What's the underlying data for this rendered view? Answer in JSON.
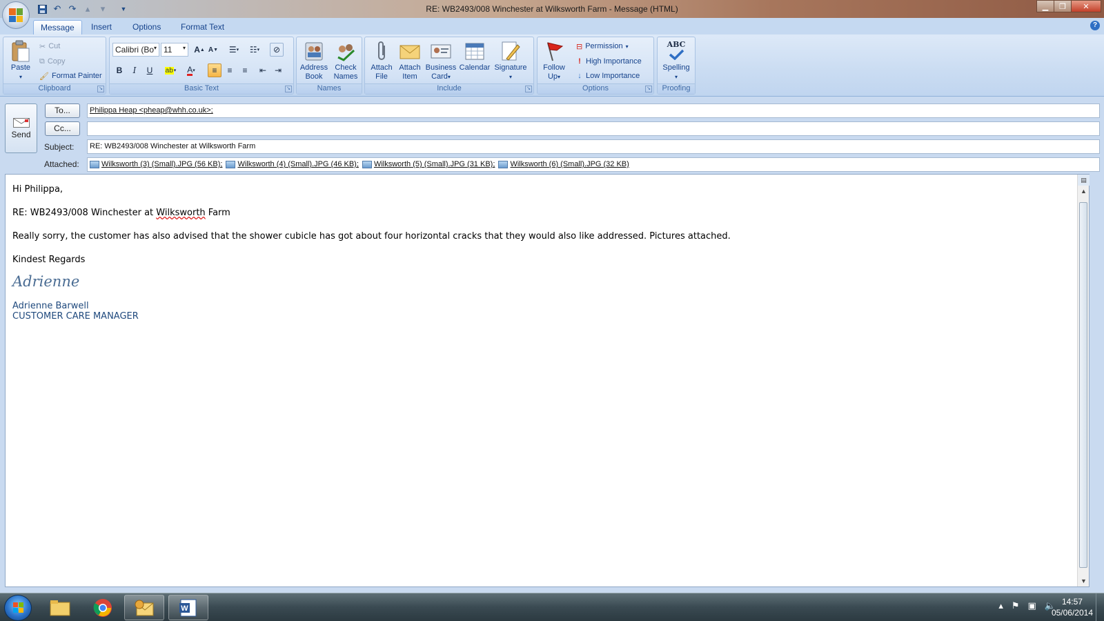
{
  "window": {
    "title": "RE: WB2493/008 Winchester at Wilksworth Farm  -  Message (HTML)",
    "controls": [
      "minimize",
      "maximize",
      "close"
    ]
  },
  "quick_access": [
    {
      "name": "save-icon",
      "glyph": "💾"
    },
    {
      "name": "undo-icon",
      "glyph": "↶"
    },
    {
      "name": "redo-icon",
      "glyph": "↷"
    },
    {
      "name": "previous-item-icon",
      "glyph": "▲"
    },
    {
      "name": "next-item-icon",
      "glyph": "▼"
    },
    {
      "name": "customize-qat-icon",
      "glyph": "▾"
    }
  ],
  "tabs": [
    {
      "label": "Message",
      "active": true
    },
    {
      "label": "Insert",
      "active": false
    },
    {
      "label": "Options",
      "active": false
    },
    {
      "label": "Format Text",
      "active": false
    }
  ],
  "ribbon": {
    "clipboard": {
      "label": "Clipboard",
      "paste": "Paste",
      "cut": "Cut",
      "copy": "Copy",
      "format_painter": "Format Painter"
    },
    "basic_text": {
      "label": "Basic Text",
      "font_name": "Calibri (Bo",
      "font_size": "11"
    },
    "names": {
      "label": "Names",
      "address_book": [
        "Address",
        "Book"
      ],
      "check_names": [
        "Check",
        "Names"
      ]
    },
    "include": {
      "label": "Include",
      "attach_file": [
        "Attach",
        "File"
      ],
      "attach_item": [
        "Attach",
        "Item"
      ],
      "business_card": [
        "Business",
        "Card"
      ],
      "calendar": "Calendar",
      "signature": "Signature"
    },
    "options": {
      "label": "Options",
      "follow_up": [
        "Follow",
        "Up"
      ],
      "permission": "Permission",
      "high_importance": "High Importance",
      "low_importance": "Low Importance"
    },
    "proofing": {
      "label": "Proofing",
      "spelling": "Spelling",
      "spelling_icon_text": "ABC"
    }
  },
  "compose": {
    "send_label": "Send",
    "to_button": "To...",
    "cc_button": "Cc...",
    "subject_label": "Subject:",
    "attached_label": "Attached:",
    "to_value": "Philippa Heap <pheap@whh.co.uk>;",
    "cc_value": "",
    "subject_value": "RE: WB2493/008 Winchester at Wilksworth Farm",
    "attachments": [
      "Wilksworth (3) (Small).JPG (56 KB);",
      "Wilksworth (4) (Small).JPG (46 KB);",
      "Wilksworth (5) (Small).JPG (31 KB);",
      "Wilksworth (6) (Small).JPG (32 KB)"
    ]
  },
  "body": {
    "greeting": "Hi Philippa,",
    "ref_prefix": "RE: WB2493/008 Winchester at ",
    "ref_misspelled": "Wilksworth",
    "ref_suffix": " Farm",
    "paragraph": "Really sorry, the customer has also advised that the shower cubicle has got about four horizontal cracks that they would also like addressed.  Pictures attached.",
    "closing": "Kindest Regards",
    "signature_script": "Adrienne",
    "sender_name": "Adrienne Barwell",
    "sender_title": "CUSTOMER CARE MANAGER"
  },
  "taskbar": {
    "apps": [
      {
        "name": "explorer-taskbar-button",
        "icon": "📁",
        "open": false
      },
      {
        "name": "chrome-taskbar-button",
        "icon": "◉",
        "open": false
      },
      {
        "name": "outlook-taskbar-button",
        "icon": "✉",
        "open": true
      },
      {
        "name": "word-taskbar-button",
        "icon": "W",
        "open": true
      }
    ],
    "time": "14:57",
    "date": "05/06/2014"
  }
}
